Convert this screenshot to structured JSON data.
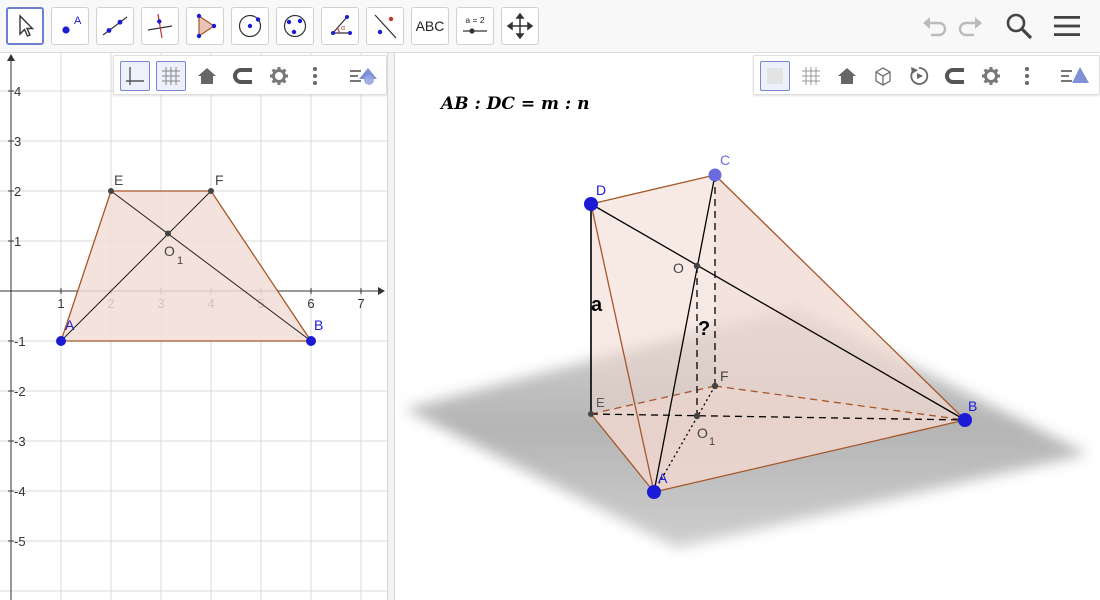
{
  "toolbar": {
    "tools": [
      {
        "name": "move-tool",
        "active": true
      },
      {
        "name": "point-tool",
        "label": "A"
      },
      {
        "name": "line-tool"
      },
      {
        "name": "perpendicular-line-tool"
      },
      {
        "name": "polygon-tool"
      },
      {
        "name": "circle-tool"
      },
      {
        "name": "conic-tool"
      },
      {
        "name": "angle-tool"
      },
      {
        "name": "reflect-tool"
      },
      {
        "name": "text-tool",
        "label": "ABC"
      },
      {
        "name": "slider-tool",
        "label": "a = 2"
      },
      {
        "name": "move-graphics-view-tool"
      }
    ],
    "right": [
      "undo-icon",
      "redo-icon",
      "search-icon",
      "menu-icon"
    ]
  },
  "graphics2d": {
    "x_ticks": [
      "1",
      "2",
      "3",
      "4",
      "5",
      "6",
      "7"
    ],
    "y_ticks": [
      "4",
      "3",
      "2",
      "1",
      "-1",
      "-2",
      "-3",
      "-4",
      "-5"
    ],
    "points": {
      "A": "A",
      "B": "B",
      "E": "E",
      "F": "F",
      "O1": "O",
      "O1_sub": "1"
    },
    "colors": {
      "fill": "#f2ddd6",
      "edge": "#a65628",
      "free_point": "#1b1bd6",
      "dep_point": "#444444"
    }
  },
  "graphics3d": {
    "formula": "AB : DC = m : n",
    "labels": {
      "A": "A",
      "B": "B",
      "C": "C",
      "D": "D",
      "E": "E",
      "F": "F",
      "O": "O",
      "O1": "O",
      "O1_sub": "1",
      "a": "a",
      "q": "?"
    },
    "colors": {
      "face": "#f1d8d0",
      "edge": "#a65628",
      "point": "#1b1bd6"
    }
  }
}
